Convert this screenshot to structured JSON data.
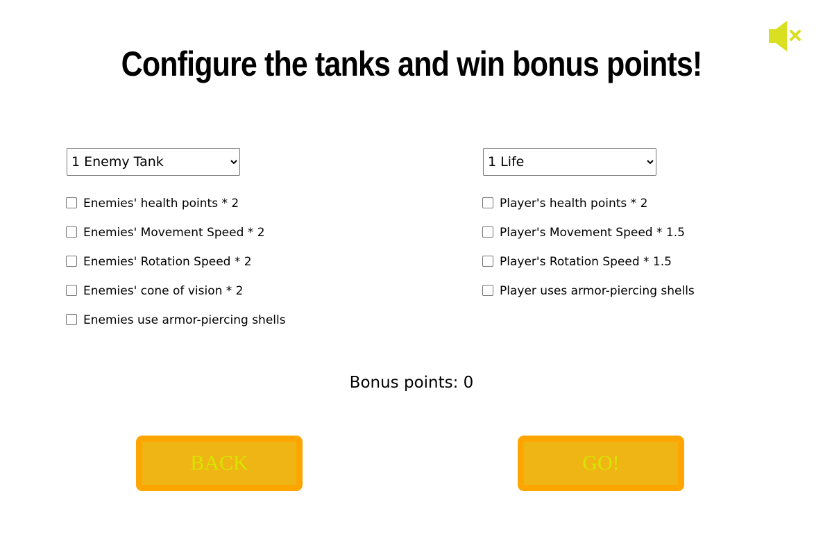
{
  "title": "Configure the tanks and win bonus points!",
  "sound": {
    "icon": "speaker-muted-icon",
    "color": "#d9e021"
  },
  "enemies": {
    "count_select": {
      "selected": "1 Enemy Tank"
    },
    "options": [
      {
        "label": "Enemies' health points * 2",
        "checked": false
      },
      {
        "label": "Enemies' Movement Speed * 2",
        "checked": false
      },
      {
        "label": "Enemies' Rotation Speed * 2",
        "checked": false
      },
      {
        "label": "Enemies' cone of vision * 2",
        "checked": false
      },
      {
        "label": "Enemies use armor-piercing shells",
        "checked": false
      }
    ]
  },
  "player": {
    "lives_select": {
      "selected": "1 Life"
    },
    "options": [
      {
        "label": "Player's health points * 2",
        "checked": false
      },
      {
        "label": "Player's Movement Speed * 1.5",
        "checked": false
      },
      {
        "label": "Player's Rotation Speed * 1.5",
        "checked": false
      },
      {
        "label": "Player uses armor-piercing shells",
        "checked": false
      }
    ]
  },
  "bonus": {
    "text": "Bonus points: 0"
  },
  "buttons": {
    "back_label": "BACK",
    "go_label": "GO!",
    "outer_color": "#ffa500",
    "inner_color": "#efb514",
    "text_color": "#d6e600"
  }
}
